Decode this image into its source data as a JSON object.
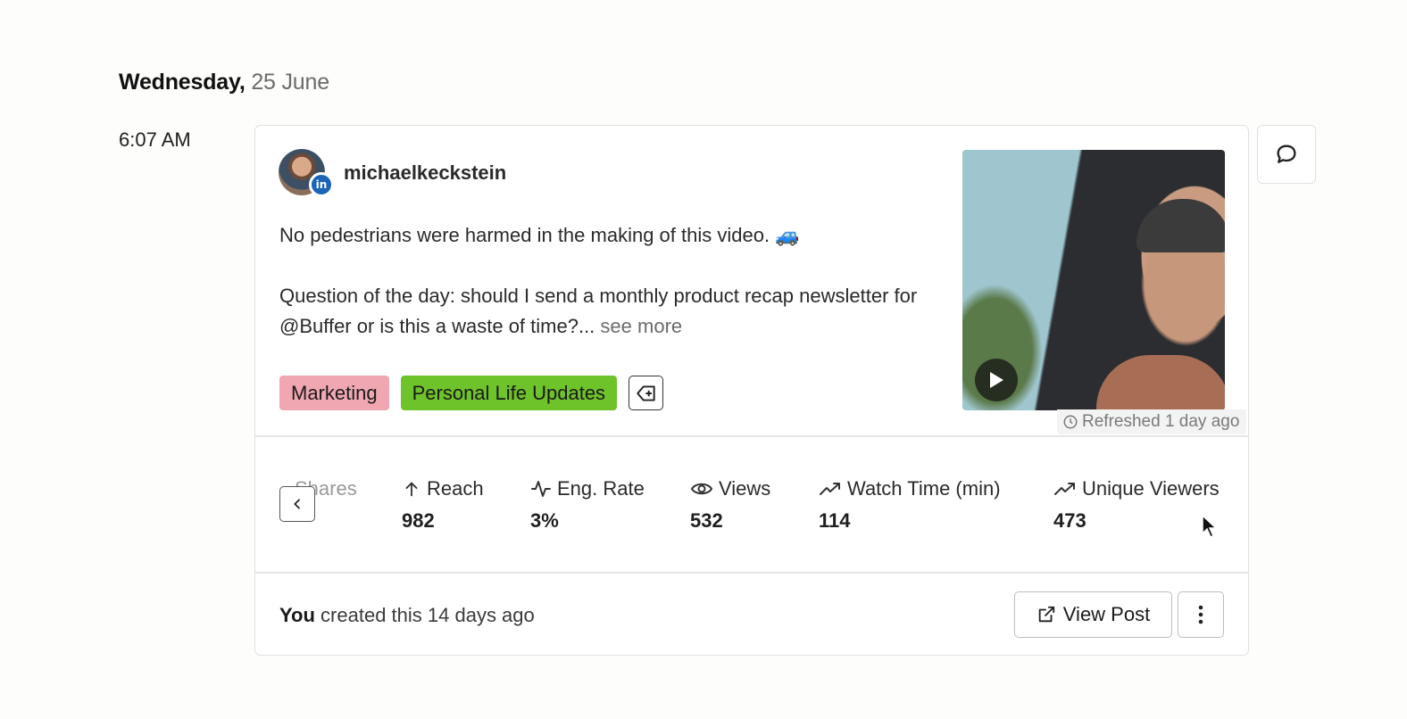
{
  "day": {
    "weekday": "Wednesday,",
    "date": "25 June"
  },
  "time": "6:07 AM",
  "post": {
    "author": "michaelkeckstein",
    "network_badge": "in",
    "text_line1": "No pedestrians were harmed in the making of this video. 🚙",
    "text_para2": "Question of the day: should I send a monthly product recap newsletter for @Buffer or is this a waste of time?...",
    "see_more": "see more",
    "tags": [
      {
        "label": "Marketing",
        "color": "#f1a7b1"
      },
      {
        "label": "Personal Life Updates",
        "color": "#6ec22a"
      }
    ],
    "refreshed": "Refreshed 1 day ago"
  },
  "metrics": [
    {
      "label": "Shares",
      "value": "",
      "icon": "share-icon"
    },
    {
      "label": "Reach",
      "value": "982",
      "icon": "arrow-up-icon"
    },
    {
      "label": "Eng. Rate",
      "value": "3%",
      "icon": "pulse-icon"
    },
    {
      "label": "Views",
      "value": "532",
      "icon": "eye-icon"
    },
    {
      "label": "Watch Time (min)",
      "value": "114",
      "icon": "trend-up-icon"
    },
    {
      "label": "Unique Viewers",
      "value": "473",
      "icon": "trend-up-icon"
    }
  ],
  "footer": {
    "created_by": "You",
    "created_rest": "created this 14 days ago",
    "view_post": "View Post"
  }
}
